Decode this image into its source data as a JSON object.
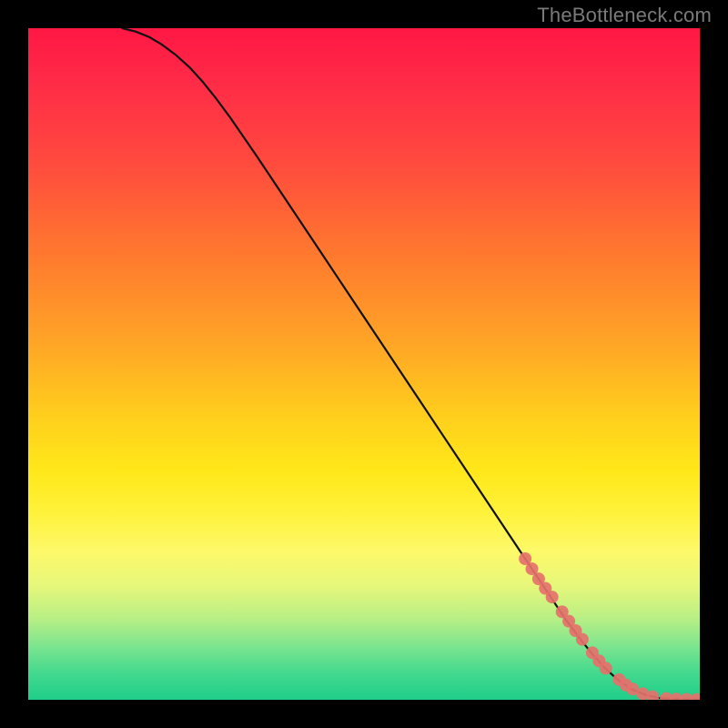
{
  "watermark": "TheBottleneck.com",
  "chart_data": {
    "type": "line",
    "title": "",
    "xlabel": "",
    "ylabel": "",
    "xlim": [
      0,
      100
    ],
    "ylim": [
      0,
      100
    ],
    "curve": {
      "name": "bottleneck-curve",
      "x": [
        14,
        16,
        18,
        20,
        22,
        24,
        26,
        28,
        30,
        34,
        38,
        42,
        46,
        50,
        54,
        58,
        62,
        66,
        70,
        74,
        78,
        80,
        82,
        84,
        86,
        88,
        90,
        92,
        94,
        96,
        98,
        100
      ],
      "y": [
        100,
        99.5,
        98.7,
        97.5,
        96,
        94.2,
        92,
        89.5,
        86.8,
        81,
        75,
        69,
        63,
        57,
        51,
        45,
        39,
        33,
        27,
        21,
        15,
        12,
        9.3,
        6.8,
        4.6,
        2.8,
        1.5,
        0.7,
        0.25,
        0.1,
        0.05,
        0.03
      ]
    },
    "markers": {
      "name": "highlighted-segment",
      "color": "#e5716b",
      "x": [
        74,
        75,
        76,
        77,
        78,
        79.5,
        80.5,
        81.5,
        82.5,
        84,
        85,
        86,
        88,
        89,
        90,
        91.5,
        93,
        95,
        96.5,
        98,
        99.5
      ],
      "y": [
        21,
        19.5,
        18,
        16.6,
        15.3,
        13.1,
        11.7,
        10.3,
        9.0,
        7.0,
        5.8,
        4.7,
        3.0,
        2.2,
        1.6,
        0.9,
        0.45,
        0.18,
        0.1,
        0.06,
        0.03
      ]
    },
    "gradient_scale": {
      "top_color": "#ff1744",
      "bottom_color": "#1fce89",
      "meaning_top": "high bottleneck",
      "meaning_bottom": "low bottleneck"
    }
  }
}
